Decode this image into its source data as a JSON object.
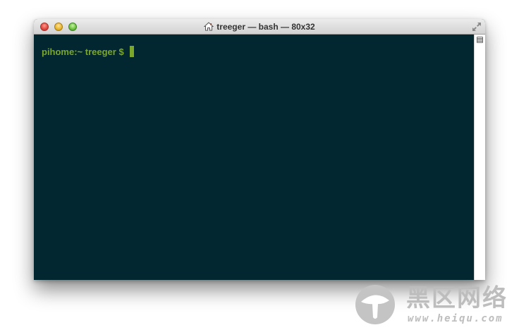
{
  "window": {
    "title": "treeger — bash — 80x32",
    "title_icon": "home-icon",
    "controls": [
      "close-button",
      "minimize-button",
      "zoom-button"
    ],
    "fullscreen_icon": "fullscreen-arrows-icon"
  },
  "terminal": {
    "prompt": "pihome:~ treeger $",
    "background": "#022730",
    "foreground": "#7ba72b"
  },
  "watermark": {
    "brand_cn": "黑区网络",
    "url": "www.heiqu.com"
  }
}
